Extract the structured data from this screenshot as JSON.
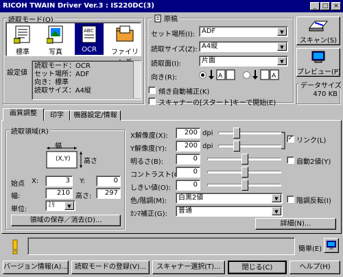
{
  "window": {
    "title": "RICOH TWAIN Driver Ver.3 : IS220DC(3)"
  },
  "read_mode": {
    "group_label": "読取モード(O)",
    "items": [
      {
        "label": "標準"
      },
      {
        "label": "写真"
      },
      {
        "label": "OCR"
      },
      {
        "label": "ファイリング"
      }
    ],
    "settings_label": "設定値",
    "settings_lines": [
      "読取モード：OCR",
      "セット場所：ADF",
      "向き：標準",
      "読取サイズ：A4縦"
    ]
  },
  "original": {
    "group_label": "原稿",
    "set_place_label": "セット場所(I):",
    "set_place_value": "ADF",
    "size_label": "読取サイズ(Z):",
    "size_value": "A4縦",
    "side_label": "読取面(I):",
    "side_value": "片面",
    "orientation_label": "向き(R):",
    "auto_skew_label": "傾き自動補正(K)",
    "start_key_label": "スキャナーの[スタート]キーで開始(E)"
  },
  "side_buttons": {
    "scan": "スキャン(S)",
    "preview": "プレビュー(P)"
  },
  "data_size": {
    "label": "データサイズ",
    "value": "470 KB"
  },
  "tabs": [
    "画質調整",
    "印字",
    "機器設定/情報"
  ],
  "read_area": {
    "group_label": "読取領域(R)",
    "width_caption": "幅",
    "height_caption": "高さ",
    "origin_caption": "(X,Y)",
    "start_label": "始点",
    "x_label": "X:",
    "x_value": "3",
    "y_label": "Y:",
    "y_value": "0",
    "width_label": "幅:",
    "width_value": "210",
    "height_label": "高さ:",
    "height_value": "297",
    "unit_label": "単位:",
    "unit_value": "ﾐﾘ",
    "save_button": "領域の保存／消去(D)..."
  },
  "adjust": {
    "x_res_label": "X解像度(X):",
    "x_res_value": "200",
    "y_res_label": "Y解像度(Y):",
    "y_res_value": "200",
    "dpi": "dpi",
    "brightness_label": "明るさ(B):",
    "brightness_value": "0",
    "contrast_label": "コントラスト(C):",
    "contrast_value": "0",
    "threshold_label": "しきい値(O):",
    "threshold_value": "0",
    "color_label": "色/階調(M):",
    "color_value": "白黒2値",
    "gamma_label": "ｶﾝﾏ補正(G):",
    "gamma_value": "普通",
    "link_label": "リンク(L)",
    "auto_binarize_label": "自動2値(Y)",
    "invert_label": "階調反転(I)",
    "detail_button": "詳細(N)..."
  },
  "status": {
    "simple_label": "簡単(E)"
  },
  "bottom_buttons": [
    "バージョン情報(A)...",
    "読取モードの登録(V)...",
    "スキャナー選択(T)...",
    "閉じる(C)",
    "ヘルプ(H)"
  ],
  "colors": {
    "titlebar": "#000080",
    "face": "#c0c0c0",
    "selection": "#000080"
  }
}
